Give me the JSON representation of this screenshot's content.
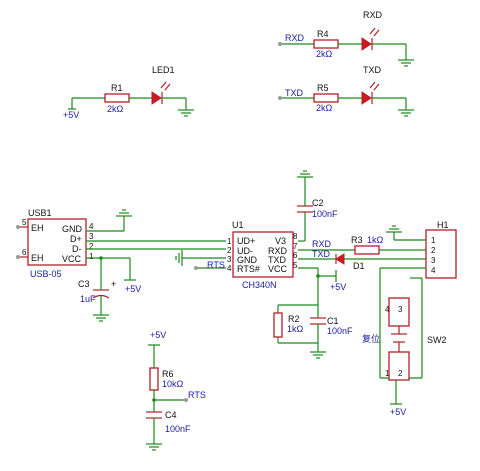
{
  "colors": {
    "wire": "#1a8a1a",
    "part": "#b0202a",
    "label": "#1a1aa0",
    "pin_text": "#111111"
  },
  "components": {
    "led1": {
      "ref": "LED1",
      "res_ref": "R1",
      "res_val": "2kΩ",
      "supply": "+5V"
    },
    "rxd_led": {
      "ref": "RXD",
      "res_ref": "R4",
      "res_val": "2kΩ",
      "net": "RXD"
    },
    "txd_led": {
      "ref": "TXD",
      "res_ref": "R5",
      "res_val": "2kΩ",
      "net": "TXD"
    },
    "usb": {
      "ref": "USB1",
      "part": "USB-05",
      "pins": [
        "EH",
        "GND",
        "D+",
        "D-",
        "VCC",
        "EH"
      ],
      "pin_nums": [
        "5",
        "4",
        "3",
        "2",
        "1",
        "6"
      ]
    },
    "u1": {
      "ref": "U1",
      "part": "CH340N",
      "left_pins": [
        "UD+",
        "UD-",
        "GND",
        "RTS#"
      ],
      "left_nums": [
        "1",
        "2",
        "3",
        "4"
      ],
      "right_pins": [
        "V3",
        "RXD",
        "TXD",
        "VCC"
      ],
      "right_nums": [
        "8",
        "7",
        "6",
        "5"
      ]
    },
    "c2": {
      "ref": "C2",
      "val": "100nF"
    },
    "c1": {
      "ref": "C1",
      "val": "100nF"
    },
    "c3": {
      "ref": "C3",
      "val": "1uF"
    },
    "c4": {
      "ref": "C4",
      "val": "100nF"
    },
    "r2": {
      "ref": "R2",
      "val": "1kΩ"
    },
    "r3": {
      "ref": "R3",
      "val": "1kΩ"
    },
    "r6": {
      "ref": "R6",
      "val": "10kΩ"
    },
    "d1": {
      "ref": "D1"
    },
    "h1": {
      "ref": "H1",
      "pins": [
        "1",
        "2",
        "3",
        "4"
      ]
    },
    "sw2": {
      "ref": "SW2",
      "label": "复位",
      "pins": [
        "4",
        "3",
        "1",
        "2"
      ]
    },
    "nets": {
      "rts": "RTS",
      "rxd": "RXD",
      "txd": "TXD",
      "plus5v": "+5V"
    }
  }
}
